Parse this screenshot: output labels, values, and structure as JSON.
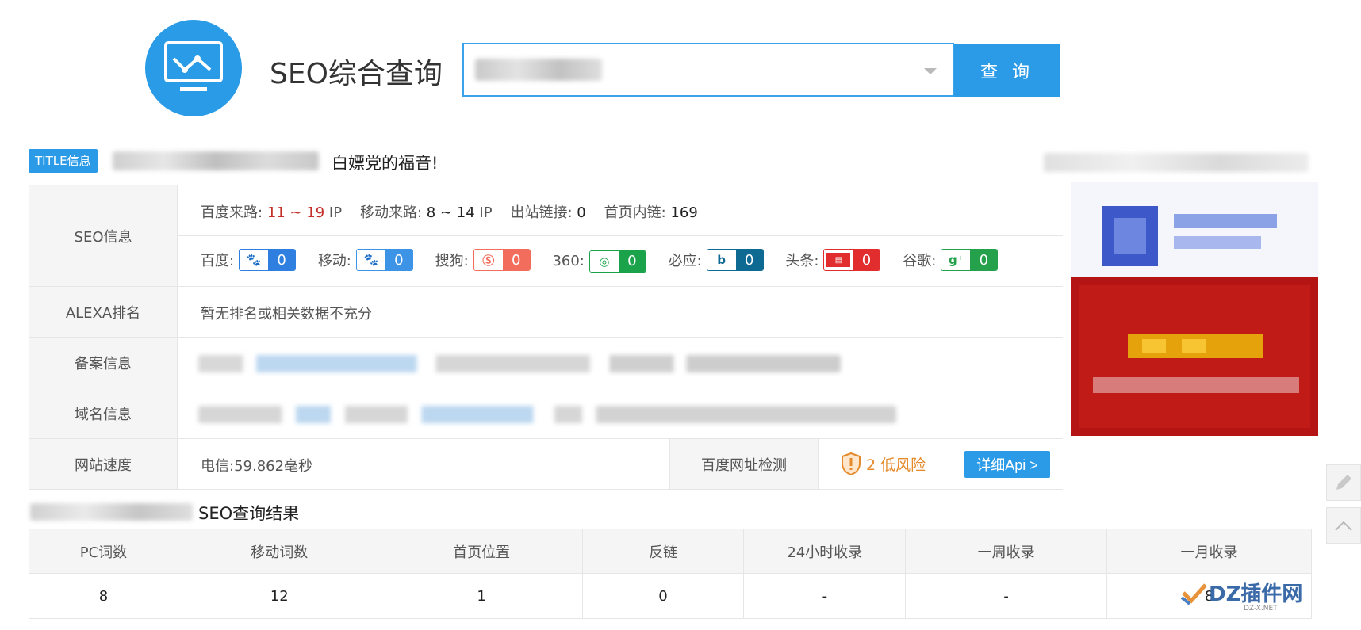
{
  "header": {
    "site_title": "SEO综合查询",
    "search_button": "查 询"
  },
  "title_info": {
    "badge": "TITLE信息",
    "title_text": "白嫖党的福音!"
  },
  "seo_info": {
    "label": "SEO信息",
    "baidu_traffic_label": "百度来路:",
    "baidu_traffic_value": "11 ~ 19",
    "ip_1": "IP",
    "mobile_traffic_label": "移动来路:",
    "mobile_traffic_value": "8 ~ 14",
    "ip_2": "IP",
    "outbound_links_label": "出站链接:",
    "outbound_links_value": "0",
    "homepage_links_label": "首页内链:",
    "homepage_links_value": "169",
    "engines": [
      {
        "label": "百度:",
        "count": "0",
        "color": "#2e7fe0",
        "icon": "baidu-paw-icon"
      },
      {
        "label": "移动:",
        "count": "0",
        "color": "#3d93e6",
        "icon": "baidu-mobile-paw-icon"
      },
      {
        "label": "搜狗:",
        "count": "0",
        "color": "#f26d5b",
        "icon": "sogou-icon"
      },
      {
        "label": "360:",
        "count": "0",
        "color": "#1aa34a",
        "icon": "360-icon"
      },
      {
        "label": "必应:",
        "count": "0",
        "color": "#0f6a93",
        "icon": "bing-icon"
      },
      {
        "label": "头条:",
        "count": "0",
        "color": "#e12d2d",
        "icon": "toutiao-icon"
      },
      {
        "label": "谷歌:",
        "count": "0",
        "color": "#24a14a",
        "icon": "google-plus-icon"
      }
    ]
  },
  "alexa": {
    "label": "ALEXA排名",
    "value": "暂无排名或相关数据不充分"
  },
  "icp": {
    "label": "备案信息"
  },
  "domain": {
    "label": "域名信息"
  },
  "speed": {
    "label": "网站速度",
    "value": "电信:59.862毫秒",
    "baidu_check_label": "百度网址检测",
    "risk": "2 低风险",
    "api_button": "详细Api >"
  },
  "results": {
    "title": "SEO查询结果",
    "headers": [
      "PC词数",
      "移动词数",
      "首页位置",
      "反链",
      "24小时收录",
      "一周收录",
      "一月收录"
    ],
    "values": [
      "8",
      "12",
      "1",
      "0",
      "-",
      "-",
      "8"
    ]
  },
  "watermark": {
    "text": "DZ插件网",
    "sub": "DZ-X.NET"
  },
  "colors": {
    "accent": "#2b9be8",
    "risk": "#e58a2b",
    "traffic_red": "#c3302a"
  }
}
